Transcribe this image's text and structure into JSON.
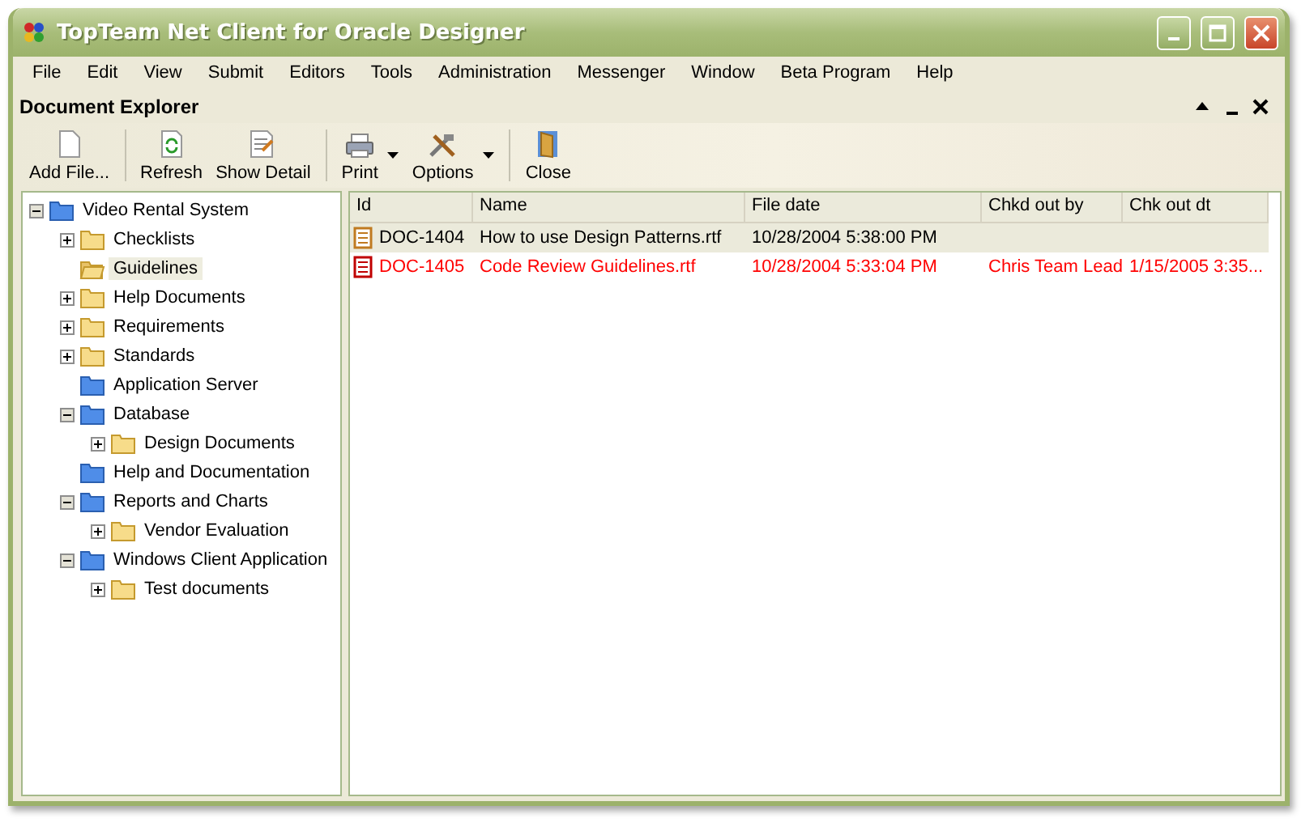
{
  "window": {
    "title": "TopTeam Net Client for Oracle Designer"
  },
  "menu": [
    "File",
    "Edit",
    "View",
    "Submit",
    "Editors",
    "Tools",
    "Administration",
    "Messenger",
    "Window",
    "Beta Program",
    "Help"
  ],
  "panel": {
    "title": "Document Explorer"
  },
  "toolbar": [
    [
      {
        "kind": "add",
        "label": "Add File...",
        "dropdown": false
      }
    ],
    [
      {
        "kind": "refresh",
        "label": "Refresh",
        "dropdown": false
      },
      {
        "kind": "detail",
        "label": "Show Detail",
        "dropdown": false
      }
    ],
    [
      {
        "kind": "print",
        "label": "Print",
        "dropdown": true
      },
      {
        "kind": "options",
        "label": "Options",
        "dropdown": true
      }
    ],
    [
      {
        "kind": "close",
        "label": "Close",
        "dropdown": false
      }
    ]
  ],
  "tree": [
    {
      "label": "Video Rental System",
      "kind": "group",
      "expanded": true,
      "selected": false,
      "children": [
        {
          "label": "Checklists",
          "kind": "folder",
          "expanded": false,
          "selected": false
        },
        {
          "label": "Guidelines",
          "kind": "folder",
          "selected": true
        },
        {
          "label": "Help Documents",
          "kind": "folder",
          "expanded": false,
          "selected": false
        },
        {
          "label": "Requirements",
          "kind": "folder",
          "expanded": false,
          "selected": false
        },
        {
          "label": "Standards",
          "kind": "folder",
          "expanded": false,
          "selected": false
        },
        {
          "label": "Application Server",
          "kind": "group",
          "selected": false
        },
        {
          "label": "Database",
          "kind": "group",
          "expanded": true,
          "selected": false,
          "children": [
            {
              "label": "Design Documents",
              "kind": "folder",
              "expanded": false,
              "selected": false
            }
          ]
        },
        {
          "label": "Help and Documentation",
          "kind": "group",
          "selected": false
        },
        {
          "label": "Reports and Charts",
          "kind": "group",
          "expanded": true,
          "selected": false,
          "children": [
            {
              "label": "Vendor Evaluation",
              "kind": "folder",
              "expanded": false,
              "selected": false
            }
          ]
        },
        {
          "label": "Windows Client Application",
          "kind": "group",
          "expanded": true,
          "selected": false,
          "children": [
            {
              "label": "Test documents",
              "kind": "folder",
              "expanded": false,
              "selected": false
            }
          ]
        }
      ]
    }
  ],
  "table": {
    "columns": [
      "Id",
      "Name",
      "File date",
      "Chkd out by",
      "Chk out dt"
    ],
    "rows": [
      {
        "cells": [
          "DOC-1404",
          "How to use Design Patterns.rtf",
          "10/28/2004 5:38:00 PM",
          "",
          ""
        ],
        "selected": true,
        "checked_out": false
      },
      {
        "cells": [
          "DOC-1405",
          "Code Review Guidelines.rtf",
          "10/28/2004 5:33:04 PM",
          "Chris Team Lead",
          "1/15/2005 3:35..."
        ],
        "selected": false,
        "checked_out": true
      }
    ]
  }
}
